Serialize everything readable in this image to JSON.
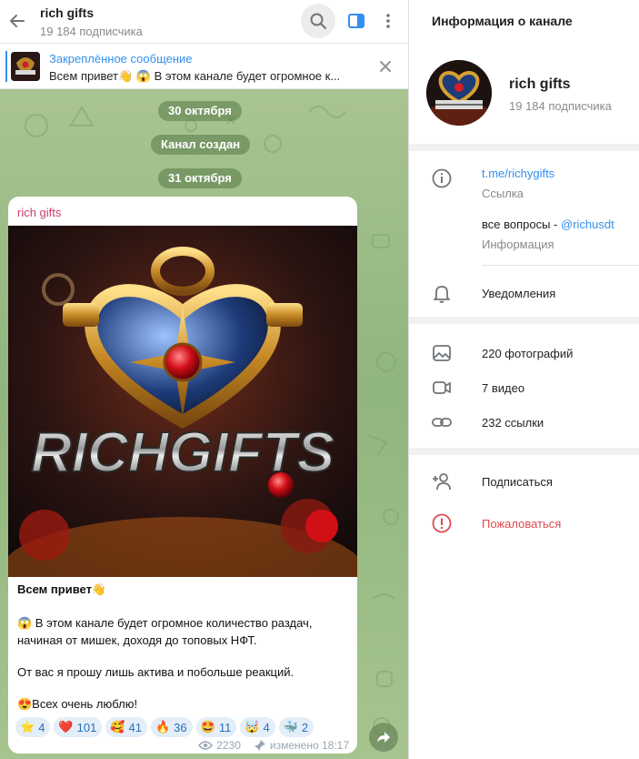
{
  "header": {
    "title": "rich gifts",
    "subscribers": "19 184 подписчика"
  },
  "pinned": {
    "label": "Закреплённое сообщение",
    "text": "Всем привет👋  😱 В этом канале будет огромное к..."
  },
  "service": {
    "date1": "30 октября",
    "created": "Канал создан",
    "date2": "31 октября"
  },
  "post": {
    "author": "rich gifts",
    "image_text": "RICHGIFTS",
    "line1": "Всем привет👋",
    "line2": "😱 В этом канале будет огромное количество раздач,",
    "line3": "начиная от мишек, доходя до топовых НФТ.",
    "line4": "От вас я прошу лишь актива и побольше реакций.",
    "line5": "😍Всех очень люблю!",
    "reactions": [
      {
        "emoji": "⭐",
        "count": "4"
      },
      {
        "emoji": "❤️",
        "count": "101"
      },
      {
        "emoji": "🥰",
        "count": "41"
      },
      {
        "emoji": "🔥",
        "count": "36"
      },
      {
        "emoji": "🤩",
        "count": "11"
      },
      {
        "emoji": "🤯",
        "count": "4"
      },
      {
        "emoji": "🐳",
        "count": "2"
      }
    ],
    "views": "2230",
    "edited": "изменено 18:17"
  },
  "info": {
    "title": "Информация о канале",
    "name": "rich gifts",
    "subscribers": "19 184 подписчика",
    "link": "t.me/richygifts",
    "link_label": "Ссылка",
    "about_prefix": "все вопросы - ",
    "about_handle": "@richusdt",
    "about_label": "Информация",
    "notifications": "Уведомления",
    "photos": "220 фотографий",
    "videos": "7 видео",
    "links": "232 ссылки",
    "subscribe": "Подписаться",
    "report": "Пожаловаться"
  },
  "colors": {
    "accent": "#3390ec",
    "author": "#c8406b",
    "danger": "#e0484e"
  }
}
